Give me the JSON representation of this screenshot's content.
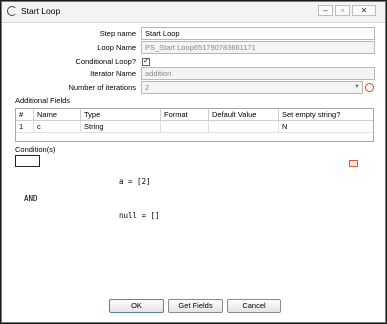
{
  "window": {
    "title": "Start Loop"
  },
  "form": {
    "step_name_label": "Step name",
    "step_name_value": "Start Loop",
    "loop_name_label": "Loop Name",
    "loop_name_value": "PS_Start Loop651790783661171",
    "conditional_label": "Conditional Loop?",
    "conditional_checked": true,
    "iterator_label": "Iterator Name",
    "iterator_value": "addition",
    "iterations_label": "Number of iterations",
    "iterations_value": "2"
  },
  "fields": {
    "section_label": "Additional Fields",
    "columns": [
      "#",
      "Name",
      "Type",
      "Format",
      "Default Value",
      "Set empty string?"
    ],
    "rows": [
      {
        "num": "1",
        "name": "c",
        "type": "String",
        "format": "",
        "default": "",
        "empty": "N"
      }
    ]
  },
  "conditions": {
    "section_label": "Condition(s)",
    "line1": "a = [2]",
    "operator": "AND",
    "line2": "null = []"
  },
  "buttons": {
    "ok": "OK",
    "get_fields": "Get Fields",
    "cancel": "Cancel"
  }
}
